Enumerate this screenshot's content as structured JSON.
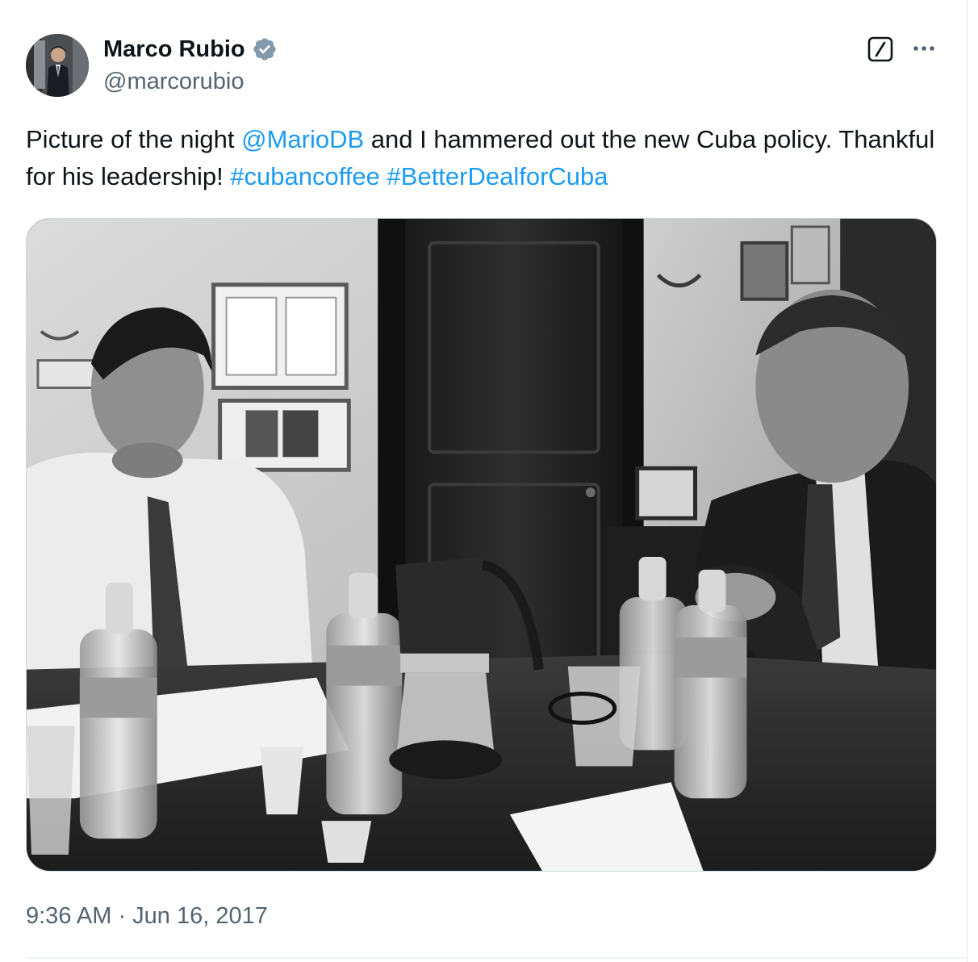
{
  "author": {
    "display_name": "Marco Rubio",
    "handle": "@marcorubio",
    "verified": true
  },
  "tweet": {
    "text_1": "Picture of the night ",
    "mention": "@MarioDB",
    "text_2": " and I hammered out the new Cuba policy. Thankful for his leadership! ",
    "hashtag_1": "#cubancoffee",
    "space": " ",
    "hashtag_2": "#BetterDealforCuba"
  },
  "media": {
    "alt": "Black and white photo of two men in a meeting at a wooden table with water bottles, an espresso maker and small coffee cups"
  },
  "meta": {
    "timestamp": "9:36 AM · Jun 16, 2017"
  },
  "icons": {
    "verified": "verified-badge-icon",
    "grok": "grok-icon",
    "more": "more-options-icon"
  },
  "colors": {
    "link": "#1d9bf0",
    "secondary_text": "#536471",
    "primary_text": "#0f1419",
    "verified_badge": "#829aab"
  }
}
